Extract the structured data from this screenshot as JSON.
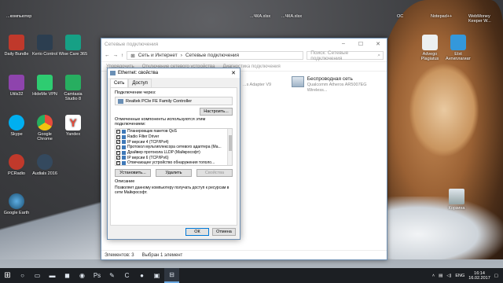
{
  "desktop": {
    "top_items": [
      {
        "label": "...компьютер"
      },
      {
        "label": "...ЧКА.xlsx"
      },
      {
        "label": "...ЧКА.xlsx"
      },
      {
        "label": "ОС"
      },
      {
        "label": "Notepad++"
      },
      {
        "label": "WebMoney Keeper W..."
      }
    ],
    "left_icons": [
      {
        "label": "Daily Bundle",
        "color": "#c0392b"
      },
      {
        "label": "Kerio Control",
        "color": "#2c3e50"
      },
      {
        "label": "Wise Care 365",
        "color": "#16a085"
      },
      {
        "label": "Utils32",
        "color": "#8e44ad"
      },
      {
        "label": "HideMe VPN",
        "color": "#2ecc71"
      },
      {
        "label": "Camtasia Studio 8",
        "color": "#27ae60"
      },
      {
        "label": "Skype",
        "color": "#00aff0"
      },
      {
        "label": "Google Chrome",
        "color": "#f1c40f"
      },
      {
        "label": "Yandex",
        "color": "#e74c3c"
      },
      {
        "label": "PCRadio",
        "color": "#c0392b"
      },
      {
        "label": "Audials 2016",
        "color": "#34495e"
      },
      {
        "label": "Google Earth",
        "color": "#2980b9"
      }
    ],
    "right_icons": [
      {
        "label": "Advego Plagiatus",
        "color": "#ecf0f1"
      },
      {
        "label": "Etxt Антиплагиат",
        "color": "#3498db"
      },
      {
        "label": "Корзина",
        "color": "#95a5a6"
      }
    ]
  },
  "explorer": {
    "title": "Сетевые подключения",
    "breadcrumb": [
      "Сеть и Интернет",
      "Сетевые подключения"
    ],
    "search_placeholder": "Поиск: Сетевые подключения",
    "commands": [
      "Упорядочить",
      "Отключение сетевого устройства",
      "Диагностика подключения"
    ],
    "items": [
      {
        "name": "Беспроводная сеть",
        "sub": "Qualcomm Atheros AR5007EG Wireless..."
      },
      {
        "name": "Ethernet",
        "sub": "...s Adapter V9"
      }
    ],
    "status": {
      "count": "Элементов: 3",
      "selected": "Выбран 1 элемент"
    }
  },
  "dialog": {
    "title": "Ethernet: свойства",
    "close": "✕",
    "tabs": [
      "Сеть",
      "Доступ"
    ],
    "connect_via_label": "Подключение через:",
    "adapter": "Realtek PCIe FE Family Controller",
    "configure_button": "Настроить...",
    "components_label": "Отмеченные компоненты используются этим подключением:",
    "components": [
      {
        "label": "Планировщик пакетов QoS",
        "checked": true
      },
      {
        "label": "Radio Filter Driver",
        "checked": true
      },
      {
        "label": "IP версии 4 (TCP/IPv4)",
        "checked": true
      },
      {
        "label": "Протокол мультиплексора сетевого адаптера (Ма...",
        "checked": false
      },
      {
        "label": "Драйвер протокола LLDP (Майкрософт)",
        "checked": true
      },
      {
        "label": "IP версии 6 (TCP/IPv6)",
        "checked": true
      },
      {
        "label": "Отвечающее устройство обнаружения тополо...",
        "checked": true
      }
    ],
    "install_button": "Установить...",
    "remove_button": "Удалить",
    "properties_button": "Свойства",
    "description_label": "Описание",
    "description_text": "Позволяет данному компьютеру получать доступ к ресурсам в сети Майкрософт.",
    "ok_button": "ОК",
    "cancel_button": "Отмена"
  },
  "taskbar": {
    "language": "ENG",
    "time": "16:14",
    "date": "16.02.2017"
  }
}
